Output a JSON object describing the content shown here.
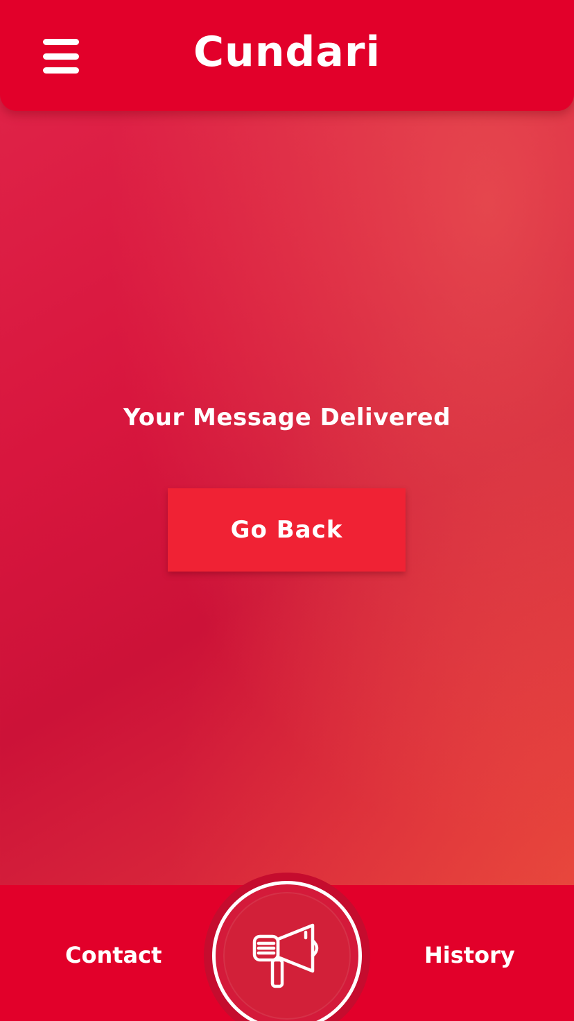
{
  "header": {
    "title": "Cundari",
    "menu_icon": "hamburger-menu-icon"
  },
  "main": {
    "message": "Your Message Delivered",
    "go_back_label": "Go Back"
  },
  "bottom_nav": {
    "contact_label": "Contact",
    "history_label": "History",
    "center_icon": "megaphone-icon"
  },
  "colors": {
    "primary": "#e2002a",
    "button": "#f02234",
    "text": "#ffffff"
  }
}
